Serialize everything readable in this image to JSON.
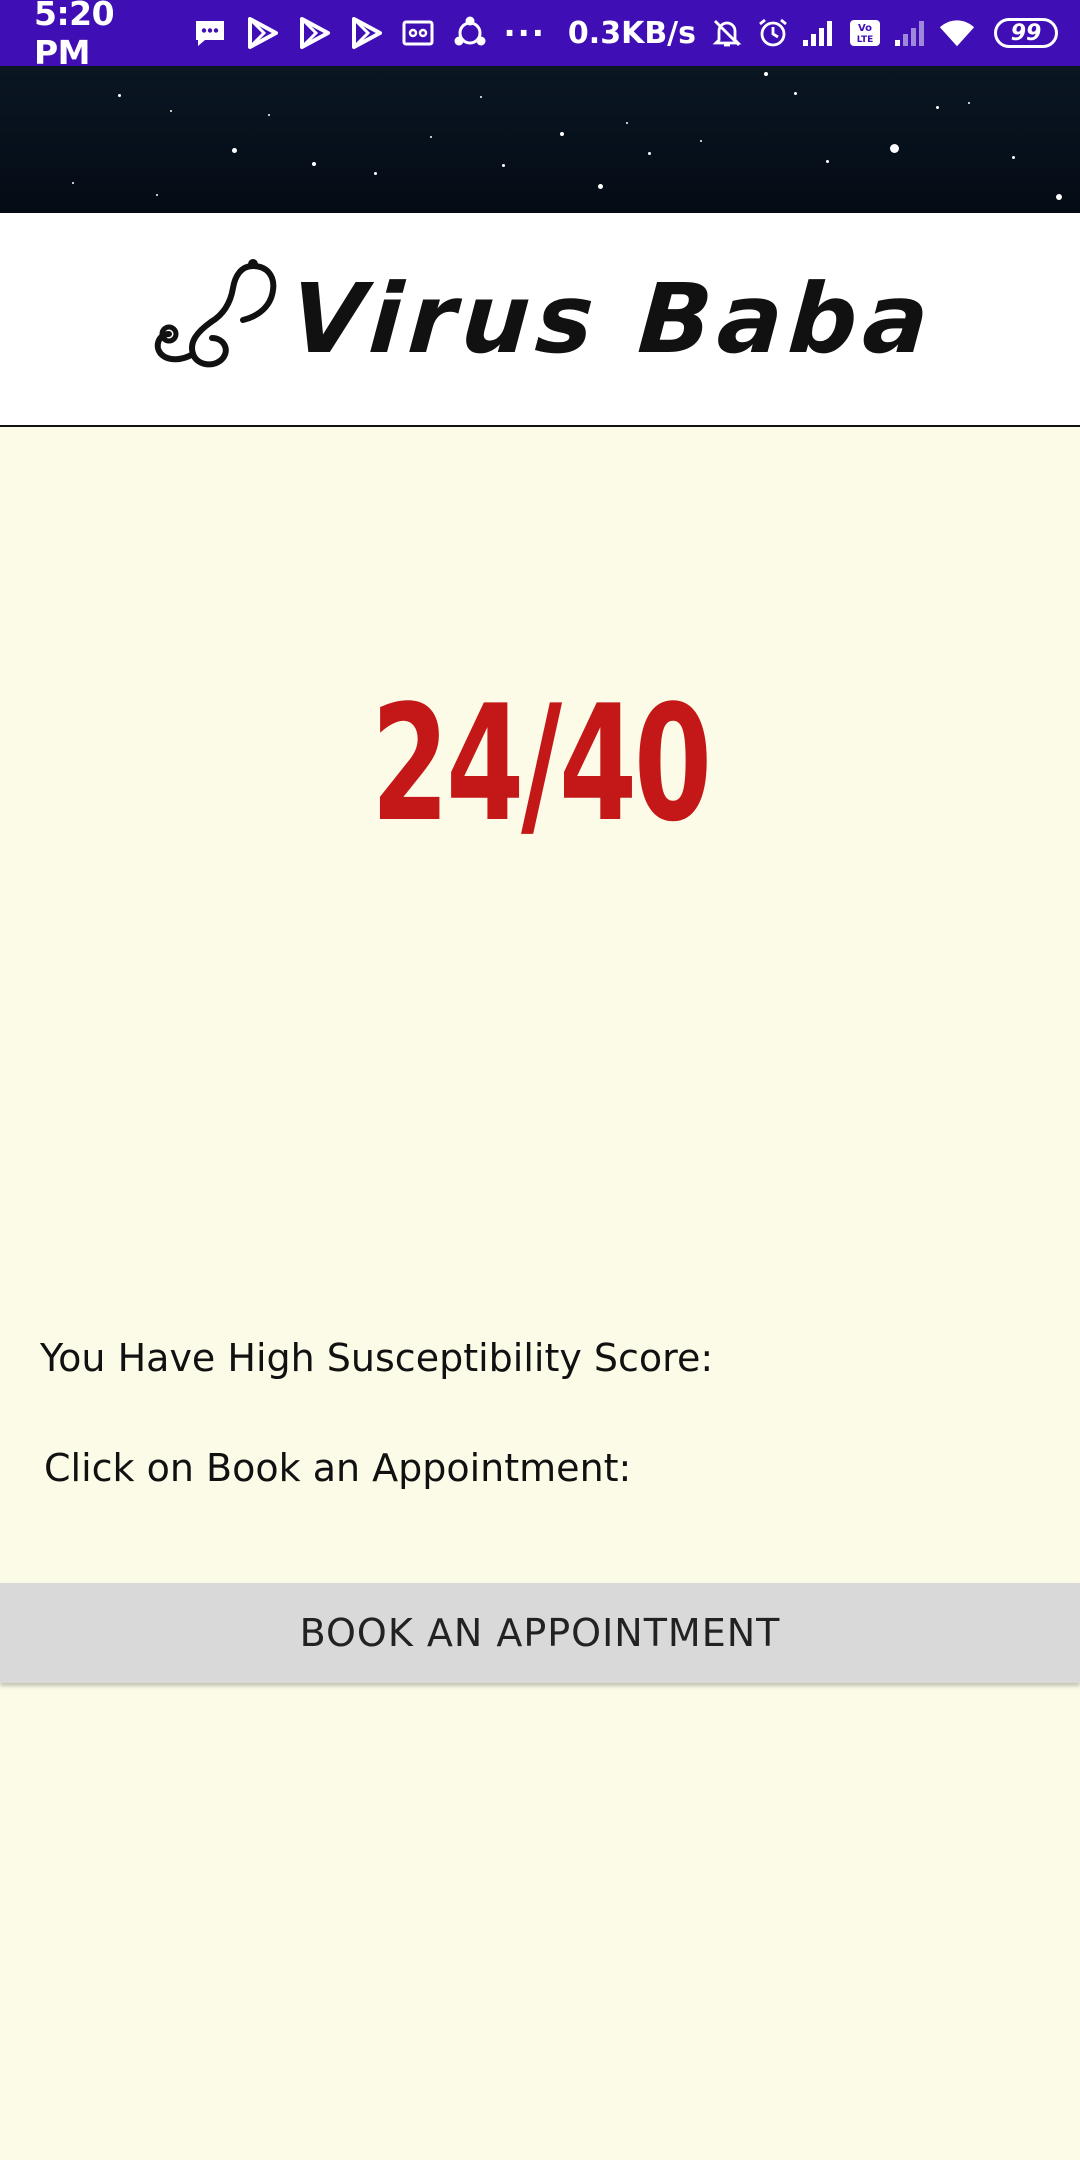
{
  "status_bar": {
    "time": "5:20 PM",
    "left_icons": [
      "message-icon",
      "play-icon",
      "play-icon",
      "play-icon",
      "card-icon",
      "share-icon"
    ],
    "more": "···",
    "network_speed": "0.3KB/s",
    "right_icons": [
      "mute-bell-icon",
      "alarm-icon",
      "signal-icon",
      "volte-icon",
      "signal-weak-icon",
      "wifi-icon"
    ],
    "battery": "99"
  },
  "header": {
    "logo_text": "Virus Baba",
    "logo_icon": "stethoscope-icon"
  },
  "result": {
    "score": "24/40",
    "score_color": "#c41818"
  },
  "messages": {
    "line1": "You Have High Susceptibility Score:",
    "line2": "Click on Book an Appointment:"
  },
  "actions": {
    "book_label": "BOOK AN APPOINTMENT"
  },
  "colors": {
    "status_bar": "#3f0fb5",
    "background": "#fbfbe8",
    "button": "#d8d9d8"
  }
}
